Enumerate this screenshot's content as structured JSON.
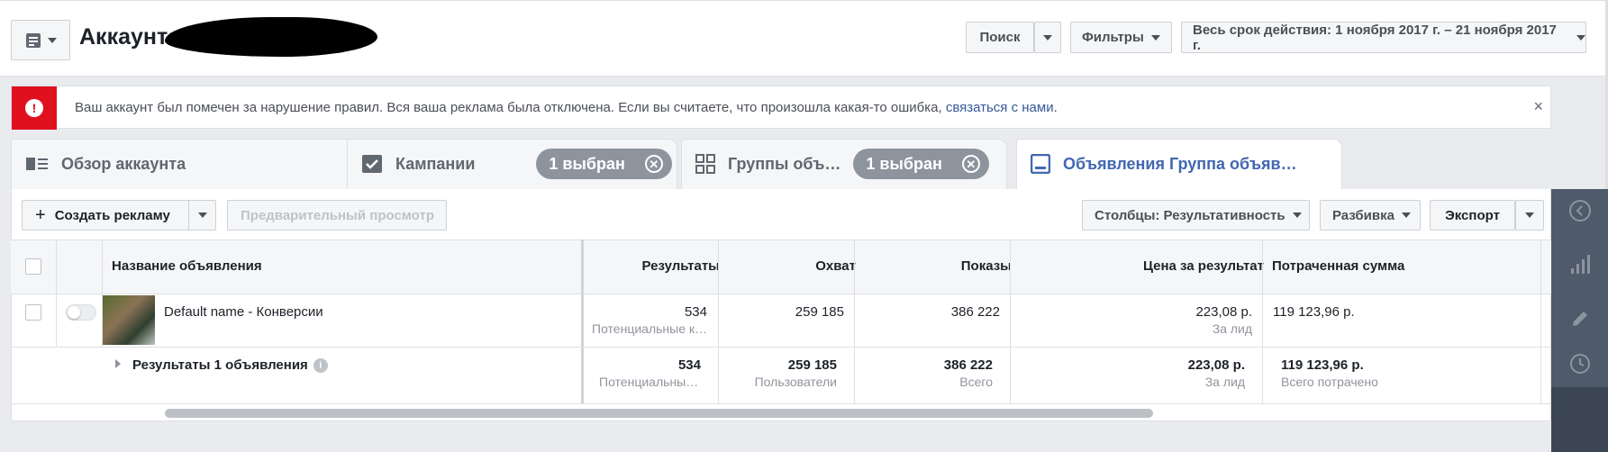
{
  "header": {
    "account_label": "Аккаунт:",
    "search_label": "Поиск",
    "filters_label": "Фильтры",
    "date_range": "Весь срок действия: 1 ноября 2017 г. – 21 ноября 2017 г."
  },
  "alert": {
    "text": "Ваш аккаунт был помечен за нарушение правил. Вся ваша реклама была отключена. Если вы считаете, что произошла какая-то ошибка, ",
    "link": "связаться с нами",
    "suffix": ".",
    "close": "×"
  },
  "tabs": [
    {
      "label": "Обзор аккаунта"
    },
    {
      "label": "Кампании",
      "pill": "1 выбран"
    },
    {
      "label": "Группы объ…",
      "pill": "1 выбран"
    },
    {
      "label": "Объявления Группа объяв…"
    }
  ],
  "toolbar": {
    "create_label": "Создать рекламу",
    "preview_label": "Предварительный просмотр",
    "columns_label": "Столбцы: Результативность",
    "breakdown_label": "Разбивка",
    "export_label": "Экспорт"
  },
  "table": {
    "headers": [
      "Название объявления",
      "Результаты",
      "Охват",
      "Показы",
      "Цена за результат",
      "Потраченная сумма"
    ],
    "row": {
      "name": "Default name - Конверсии",
      "results": "534",
      "results_sub": "Потенциальные к…",
      "reach": "259 185",
      "impressions": "386 222",
      "cost": "223,08 р.",
      "cost_sub": "За лид",
      "spent": "119 123,96 р."
    },
    "summary": {
      "label": "Результаты 1 объявления",
      "results": "534",
      "results_sub": "Потенциальны…",
      "reach": "259 185",
      "reach_sub": "Пользователи",
      "impressions": "386 222",
      "impressions_sub": "Всего",
      "cost": "223,08 р.",
      "cost_sub": "За лид",
      "spent": "119 123,96 р.",
      "spent_sub": "Всего потрачено"
    }
  },
  "colors": {
    "accent": "#4267b2",
    "alert": "#e0101f",
    "rail": "#3b4554"
  }
}
